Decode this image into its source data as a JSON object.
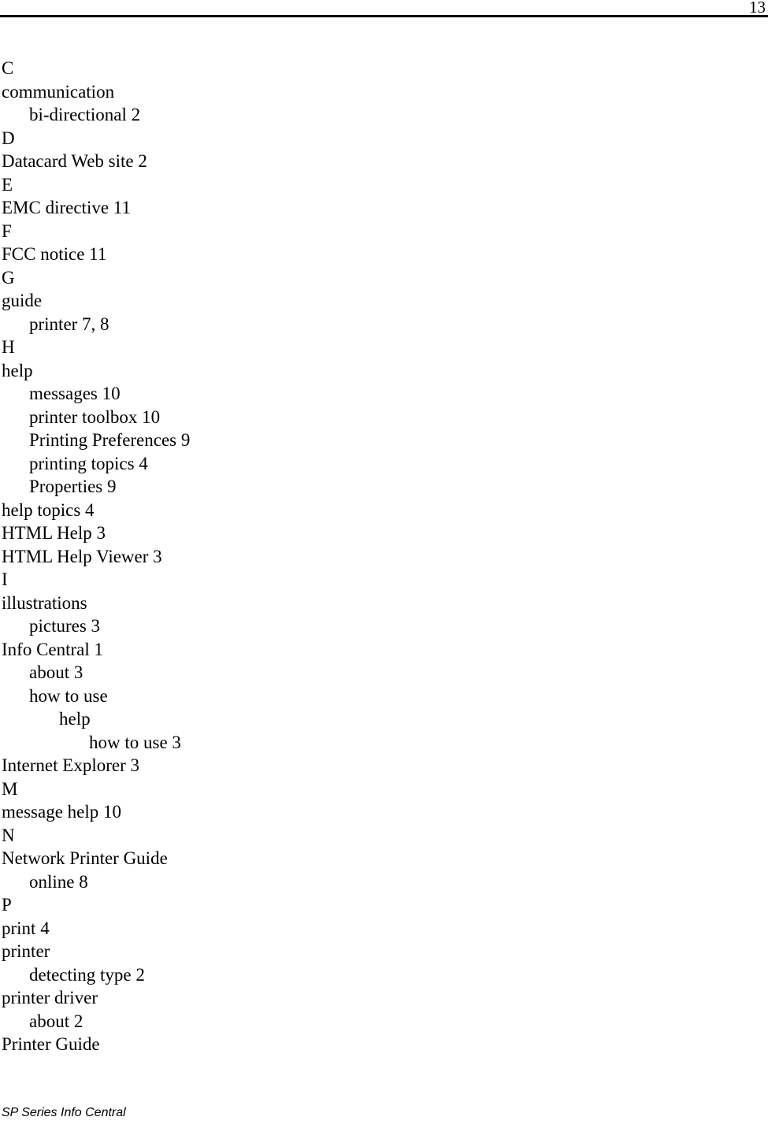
{
  "header": {
    "page_number": "13"
  },
  "index": {
    "entries": [
      {
        "text": "C",
        "level": 0
      },
      {
        "text": "communication",
        "level": 0
      },
      {
        "text": "bi-directional 2",
        "level": 1
      },
      {
        "text": "D",
        "level": 0
      },
      {
        "text": "Datacard Web site 2",
        "level": 0
      },
      {
        "text": "E",
        "level": 0
      },
      {
        "text": "EMC directive 11",
        "level": 0
      },
      {
        "text": "F",
        "level": 0
      },
      {
        "text": "FCC notice 11",
        "level": 0
      },
      {
        "text": "G",
        "level": 0
      },
      {
        "text": "guide",
        "level": 0
      },
      {
        "text": "printer 7, 8",
        "level": 1
      },
      {
        "text": "H",
        "level": 0
      },
      {
        "text": "help",
        "level": 0
      },
      {
        "text": "messages 10",
        "level": 1
      },
      {
        "text": "printer toolbox 10",
        "level": 1
      },
      {
        "text": "Printing Preferences 9",
        "level": 1
      },
      {
        "text": "printing topics 4",
        "level": 1
      },
      {
        "text": "Properties 9",
        "level": 1
      },
      {
        "text": "help topics 4",
        "level": 0
      },
      {
        "text": "HTML Help 3",
        "level": 0
      },
      {
        "text": "HTML Help Viewer 3",
        "level": 0
      },
      {
        "text": "I",
        "level": 0
      },
      {
        "text": "illustrations",
        "level": 0
      },
      {
        "text": "pictures 3",
        "level": 1
      },
      {
        "text": "Info Central 1",
        "level": 0
      },
      {
        "text": "about 3",
        "level": 1
      },
      {
        "text": "how to use",
        "level": 1
      },
      {
        "text": "help",
        "level": 2
      },
      {
        "text": "how to use 3",
        "level": 3
      },
      {
        "text": "Internet Explorer 3",
        "level": 0
      },
      {
        "text": "M",
        "level": 0
      },
      {
        "text": "message help 10",
        "level": 0
      },
      {
        "text": "N",
        "level": 0
      },
      {
        "text": "Network Printer Guide",
        "level": 0
      },
      {
        "text": "online 8",
        "level": 1
      },
      {
        "text": "P",
        "level": 0
      },
      {
        "text": "print 4",
        "level": 0
      },
      {
        "text": "printer",
        "level": 0
      },
      {
        "text": "detecting type 2",
        "level": 1
      },
      {
        "text": "printer driver",
        "level": 0
      },
      {
        "text": "about 2",
        "level": 1
      },
      {
        "text": "Printer Guide",
        "level": 0
      }
    ]
  },
  "footer": {
    "text": "SP Series Info Central"
  }
}
